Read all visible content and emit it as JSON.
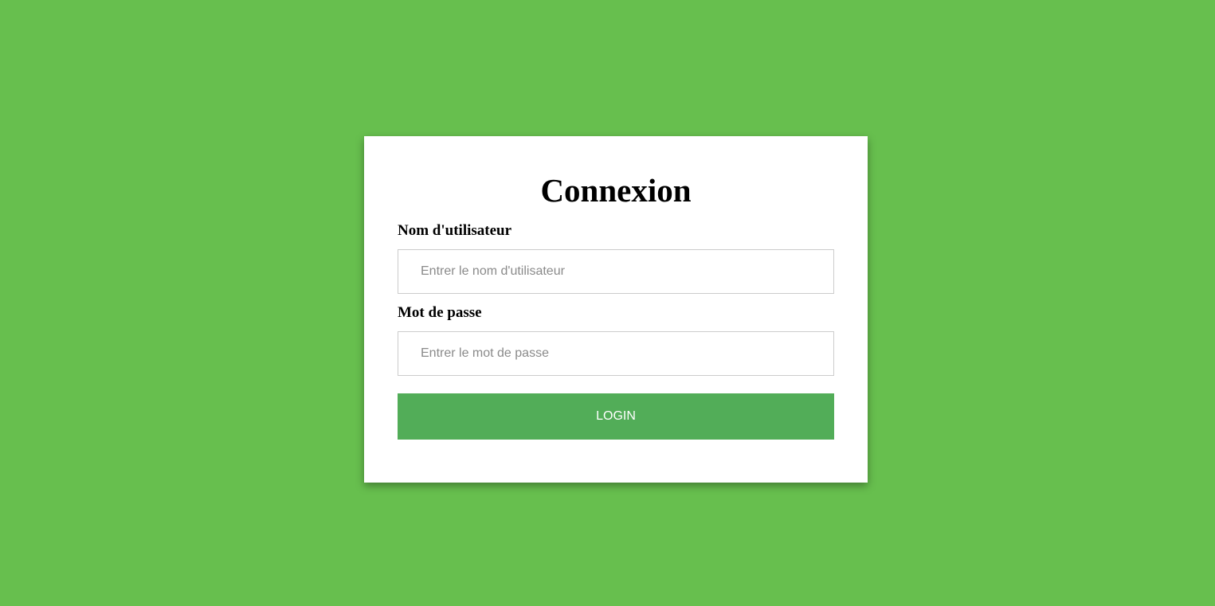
{
  "colors": {
    "background": "#67bf4e",
    "card": "#ffffff",
    "button": "#52ad58",
    "button_text": "#ffffff"
  },
  "login_form": {
    "title": "Connexion",
    "username": {
      "label": "Nom d'utilisateur",
      "value": "",
      "placeholder": "Entrer le nom d'utilisateur"
    },
    "password": {
      "label": "Mot de passe",
      "value": "",
      "placeholder": "Entrer le mot de passe"
    },
    "submit_label": "LOGIN"
  }
}
